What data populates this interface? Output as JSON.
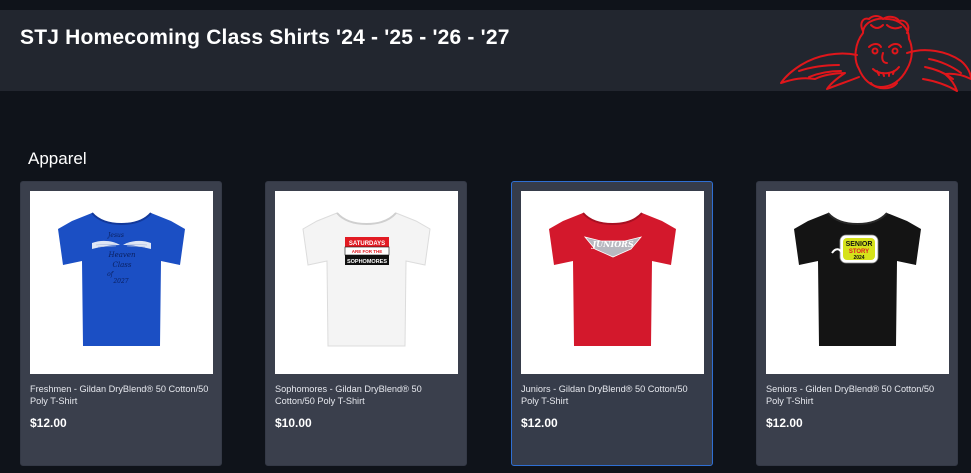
{
  "header": {
    "title": "STJ Homecoming Class Shirts '24 - '25 - '26 - '27"
  },
  "section": {
    "title": "Apparel"
  },
  "products": [
    {
      "name": "Freshmen - Gildan DryBlend® 50 Cotton/50 Poly T-Shirt",
      "price": "$12.00",
      "shirt_color": "#1b4fc4",
      "print_text": [
        "Jesus",
        "Heaven",
        "Class",
        "of",
        "2027"
      ]
    },
    {
      "name": "Sophomores - Gildan DryBlend® 50 Cotton/50 Poly T-Shirt",
      "price": "$10.00",
      "shirt_color": "#f4f4f4",
      "print_text": [
        "SATURDAYS",
        "ARE FOR THE",
        "SOPHOMORES"
      ]
    },
    {
      "name": "Juniors - Gildan DryBlend® 50 Cotton/50 Poly T-Shirt",
      "price": "$12.00",
      "shirt_color": "#d3182c",
      "print_text": [
        "JUNIORS"
      ]
    },
    {
      "name": "Seniors - Gilden DryBlend® 50 Cotton/50 Poly T-Shirt",
      "price": "$12.00",
      "shirt_color": "#141414",
      "print_text": [
        "SENIOR",
        "STORY",
        "2024"
      ]
    }
  ],
  "colors": {
    "page_bg": "#0f131a",
    "header_bg": "#22262f",
    "card_bg": "#3a3f4c",
    "active_border": "#2f6fd3",
    "logo_red": "#e0161b"
  }
}
